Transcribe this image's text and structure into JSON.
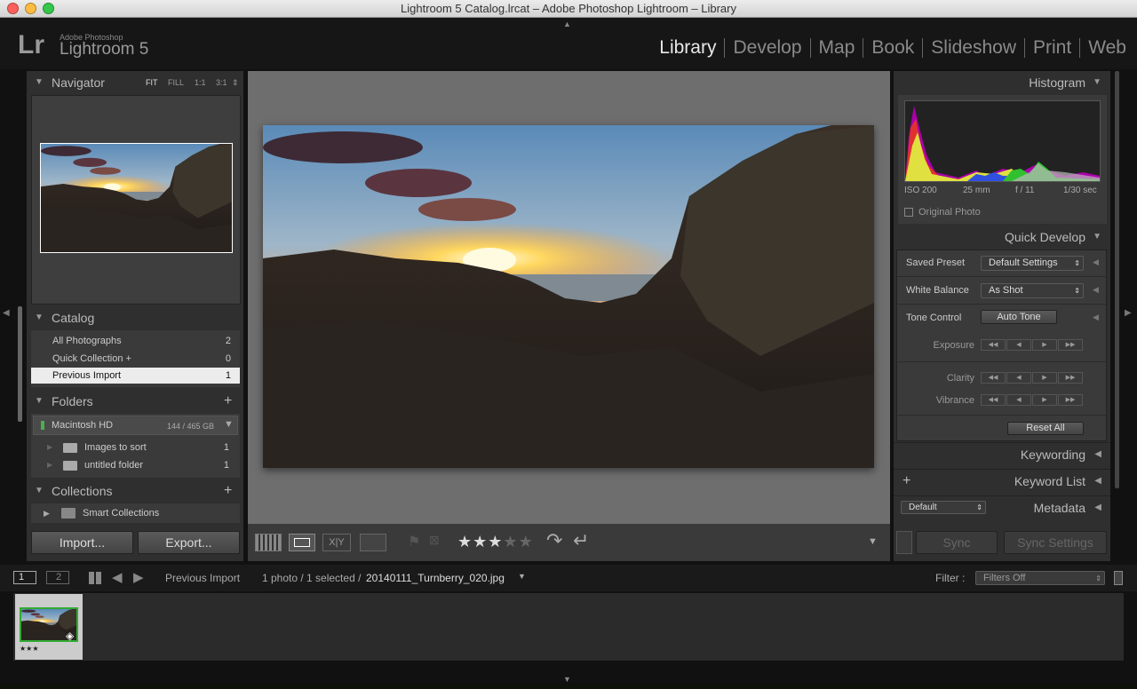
{
  "window": {
    "title": "Lightroom 5 Catalog.lrcat – Adobe Photoshop Lightroom – Library"
  },
  "brand": {
    "lr": "Lr",
    "small": "Adobe Photoshop",
    "big": "Lightroom 5"
  },
  "modules": [
    "Library",
    "Develop",
    "Map",
    "Book",
    "Slideshow",
    "Print",
    "Web"
  ],
  "navigator": {
    "title": "Navigator",
    "zoom": [
      "FIT",
      "FILL",
      "1:1",
      "3:1"
    ]
  },
  "catalog": {
    "title": "Catalog",
    "items": [
      {
        "label": "All Photographs",
        "count": "2"
      },
      {
        "label": "Quick Collection  +",
        "count": "0"
      },
      {
        "label": "Previous Import",
        "count": "1"
      }
    ]
  },
  "folders": {
    "title": "Folders",
    "add": "+",
    "volume": {
      "name": "Macintosh HD",
      "size": "144 / 465 GB"
    },
    "items": [
      {
        "label": "Images to sort",
        "count": "1"
      },
      {
        "label": "untitled folder",
        "count": "1"
      }
    ]
  },
  "collections": {
    "title": "Collections",
    "add": "+",
    "items": [
      {
        "label": "Smart Collections"
      }
    ]
  },
  "left_buttons": {
    "import": "Import...",
    "export": "Export..."
  },
  "toolbar": {
    "stars": "★★★★★",
    "rating": 3
  },
  "histogram": {
    "title": "Histogram",
    "iso": "ISO 200",
    "focal": "25 mm",
    "aperture": "f / 11",
    "shutter": "1/30 sec",
    "original": "Original Photo"
  },
  "quick_develop": {
    "title": "Quick Develop",
    "saved_preset_label": "Saved Preset",
    "saved_preset_value": "Default Settings",
    "wb_label": "White Balance",
    "wb_value": "As Shot",
    "tone_label": "Tone Control",
    "auto_tone": "Auto Tone",
    "exposure": "Exposure",
    "clarity": "Clarity",
    "vibrance": "Vibrance",
    "reset": "Reset All"
  },
  "right_sections": {
    "keywording": "Keywording",
    "keyword_list": "Keyword List",
    "keyword_add": "+",
    "metadata": "Metadata",
    "metadata_preset": "Default"
  },
  "sync": {
    "sync": "Sync",
    "sync_settings": "Sync Settings"
  },
  "filmstrip": {
    "page1": "1",
    "page2": "2",
    "source": "Previous Import",
    "status": "1 photo / 1 selected /",
    "filename": "20140111_Turnberry_020.jpg",
    "filter_label": "Filter :",
    "filter_value": "Filters Off",
    "thumb_stars": "★★★"
  },
  "colors": {
    "accent": "#e8e8e8",
    "panel": "#2f2f2f",
    "selected": "#ececec"
  }
}
